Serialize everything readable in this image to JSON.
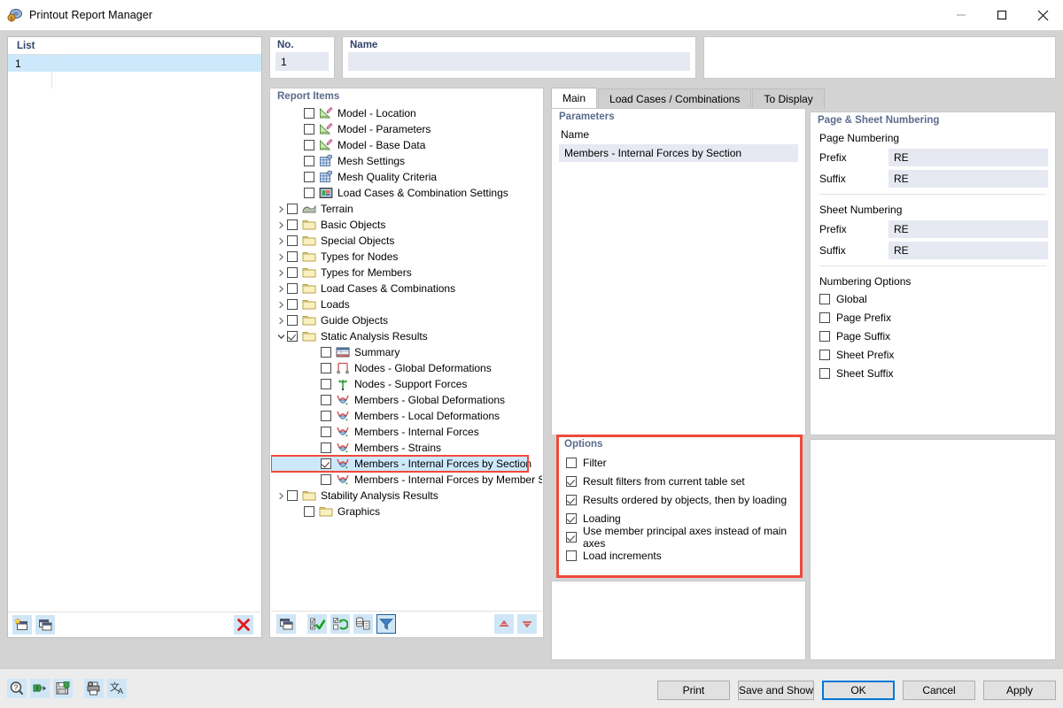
{
  "window": {
    "title": "Printout Report Manager",
    "icon": "report-manager-icon",
    "minimize": "—",
    "maximize": "□",
    "close": "✕"
  },
  "list": {
    "header": "List",
    "rows": [
      {
        "no": "1",
        "name": "",
        "selected": true
      },
      {
        "no": "",
        "name": "",
        "selected": false
      }
    ],
    "toolbar": [
      {
        "name": "new-report-button",
        "icon": "new-window-star-icon"
      },
      {
        "name": "copy-report-button",
        "icon": "copy-window-icon"
      },
      {
        "name": "delete-report-button",
        "icon": "red-x-icon"
      }
    ]
  },
  "fields": {
    "no_label": "No.",
    "no_value": "1",
    "name_label": "Name",
    "name_value": ""
  },
  "tree": {
    "title": "Report Items",
    "nodes": [
      {
        "label": "Model - Location",
        "indent": 1,
        "twist": "",
        "checked": false,
        "icon": "model-location-icon"
      },
      {
        "label": "Model - Parameters",
        "indent": 1,
        "twist": "",
        "checked": false,
        "icon": "model-parameters-icon"
      },
      {
        "label": "Model - Base Data",
        "indent": 1,
        "twist": "",
        "checked": false,
        "icon": "model-base-data-icon"
      },
      {
        "label": "Mesh Settings",
        "indent": 1,
        "twist": "",
        "checked": false,
        "icon": "mesh-settings-icon"
      },
      {
        "label": "Mesh Quality Criteria",
        "indent": 1,
        "twist": "",
        "checked": false,
        "icon": "mesh-quality-icon"
      },
      {
        "label": "Load Cases & Combination Settings",
        "indent": 1,
        "twist": "",
        "checked": false,
        "icon": "load-case-settings-icon"
      },
      {
        "label": "Terrain",
        "indent": 0,
        "twist": "collapsed",
        "checked": false,
        "icon": "terrain-icon"
      },
      {
        "label": "Basic Objects",
        "indent": 0,
        "twist": "collapsed",
        "checked": false,
        "icon": "folder-icon"
      },
      {
        "label": "Special Objects",
        "indent": 0,
        "twist": "collapsed",
        "checked": false,
        "icon": "folder-icon"
      },
      {
        "label": "Types for Nodes",
        "indent": 0,
        "twist": "collapsed",
        "checked": false,
        "icon": "folder-icon"
      },
      {
        "label": "Types for Members",
        "indent": 0,
        "twist": "collapsed",
        "checked": false,
        "icon": "folder-icon"
      },
      {
        "label": "Load Cases & Combinations",
        "indent": 0,
        "twist": "collapsed",
        "checked": false,
        "icon": "folder-icon"
      },
      {
        "label": "Loads",
        "indent": 0,
        "twist": "collapsed",
        "checked": false,
        "icon": "folder-icon"
      },
      {
        "label": "Guide Objects",
        "indent": 0,
        "twist": "collapsed",
        "checked": false,
        "icon": "folder-icon"
      },
      {
        "label": "Static Analysis Results",
        "indent": 0,
        "twist": "expanded",
        "checked": true,
        "icon": "folder-icon"
      },
      {
        "label": "Summary",
        "indent": 2,
        "twist": "",
        "checked": false,
        "icon": "summary-table-icon"
      },
      {
        "label": "Nodes - Global Deformations",
        "indent": 2,
        "twist": "",
        "checked": false,
        "icon": "nodes-deformation-icon"
      },
      {
        "label": "Nodes - Support Forces",
        "indent": 2,
        "twist": "",
        "checked": false,
        "icon": "support-forces-icon"
      },
      {
        "label": "Members - Global Deformations",
        "indent": 2,
        "twist": "",
        "checked": false,
        "icon": "member-diagram-icon"
      },
      {
        "label": "Members - Local Deformations",
        "indent": 2,
        "twist": "",
        "checked": false,
        "icon": "member-diagram-icon"
      },
      {
        "label": "Members - Internal Forces",
        "indent": 2,
        "twist": "",
        "checked": false,
        "icon": "member-diagram-icon"
      },
      {
        "label": "Members - Strains",
        "indent": 2,
        "twist": "",
        "checked": false,
        "icon": "member-diagram-icon"
      },
      {
        "label": "Members - Internal Forces by Section",
        "indent": 2,
        "twist": "",
        "checked": true,
        "icon": "member-diagram-icon",
        "selected": true,
        "highlighted": true
      },
      {
        "label": "Members - Internal Forces by Member Set",
        "indent": 2,
        "twist": "",
        "checked": false,
        "icon": "member-diagram-icon"
      },
      {
        "label": "Stability Analysis Results",
        "indent": 0,
        "twist": "collapsed",
        "checked": false,
        "icon": "folder-icon"
      },
      {
        "label": "Graphics",
        "indent": 1,
        "twist": "",
        "checked": false,
        "icon": "folder-icon"
      }
    ],
    "toolbar": [
      {
        "name": "new-item-button",
        "icon": "copy-window-icon"
      },
      {
        "name": "select-all-button",
        "icon": "check-all-icon"
      },
      {
        "name": "invert-selection-button",
        "icon": "invert-selection-icon"
      },
      {
        "name": "details-button",
        "icon": "list-details-icon"
      },
      {
        "name": "filter-button",
        "icon": "filter-funnel-icon",
        "active": true
      },
      {
        "name": "move-up-button",
        "icon": "arrow-up-icon"
      },
      {
        "name": "move-down-button",
        "icon": "arrow-down-icon"
      }
    ]
  },
  "tabs": [
    {
      "label": "Main",
      "active": true
    },
    {
      "label": "Load Cases / Combinations",
      "active": false
    },
    {
      "label": "To Display",
      "active": false
    }
  ],
  "parameters": {
    "title": "Parameters",
    "column_header": "Name",
    "rows": [
      "Members - Internal Forces by Section"
    ]
  },
  "numbering": {
    "title": "Page & Sheet Numbering",
    "page_group": "Page Numbering",
    "page_prefix_label": "Prefix",
    "page_prefix_value": "RE",
    "page_suffix_label": "Suffix",
    "page_suffix_value": "RE",
    "sheet_group": "Sheet Numbering",
    "sheet_prefix_label": "Prefix",
    "sheet_prefix_value": "RE",
    "sheet_suffix_label": "Suffix",
    "sheet_suffix_value": "RE",
    "options_group": "Numbering Options",
    "options": [
      {
        "label": "Global",
        "checked": false
      },
      {
        "label": "Page Prefix",
        "checked": false
      },
      {
        "label": "Page Suffix",
        "checked": false
      },
      {
        "label": "Sheet Prefix",
        "checked": false
      },
      {
        "label": "Sheet Suffix",
        "checked": false
      }
    ]
  },
  "options": {
    "title": "Options",
    "highlight_color": "#ef4a3a",
    "items": [
      {
        "label": "Filter",
        "checked": false
      },
      {
        "label": "Result filters from current table set",
        "checked": true
      },
      {
        "label": "Results ordered by objects, then by loading",
        "checked": true
      },
      {
        "label": "Loading",
        "checked": true
      },
      {
        "label": "Use member principal axes instead of main axes",
        "checked": true
      },
      {
        "label": "Load increments",
        "checked": false
      }
    ]
  },
  "status_toolbar": [
    {
      "name": "help-button",
      "icon": "question-magnifier-icon"
    },
    {
      "name": "export-button",
      "icon": "export-arrow-icon"
    },
    {
      "name": "save-template-button",
      "icon": "save-disk-icon"
    },
    {
      "name": "printer-settings-button",
      "icon": "printer-gear-icon"
    },
    {
      "name": "language-button",
      "icon": "translate-icon"
    }
  ],
  "dialog_buttons": [
    {
      "label": "Print",
      "name": "print-button",
      "default": false
    },
    {
      "label": "Save and Show",
      "name": "save-and-show-button",
      "default": false
    },
    {
      "label": "OK",
      "name": "ok-button",
      "default": true
    },
    {
      "label": "Cancel",
      "name": "cancel-button",
      "default": false
    },
    {
      "label": "Apply",
      "name": "apply-button",
      "default": false
    }
  ]
}
